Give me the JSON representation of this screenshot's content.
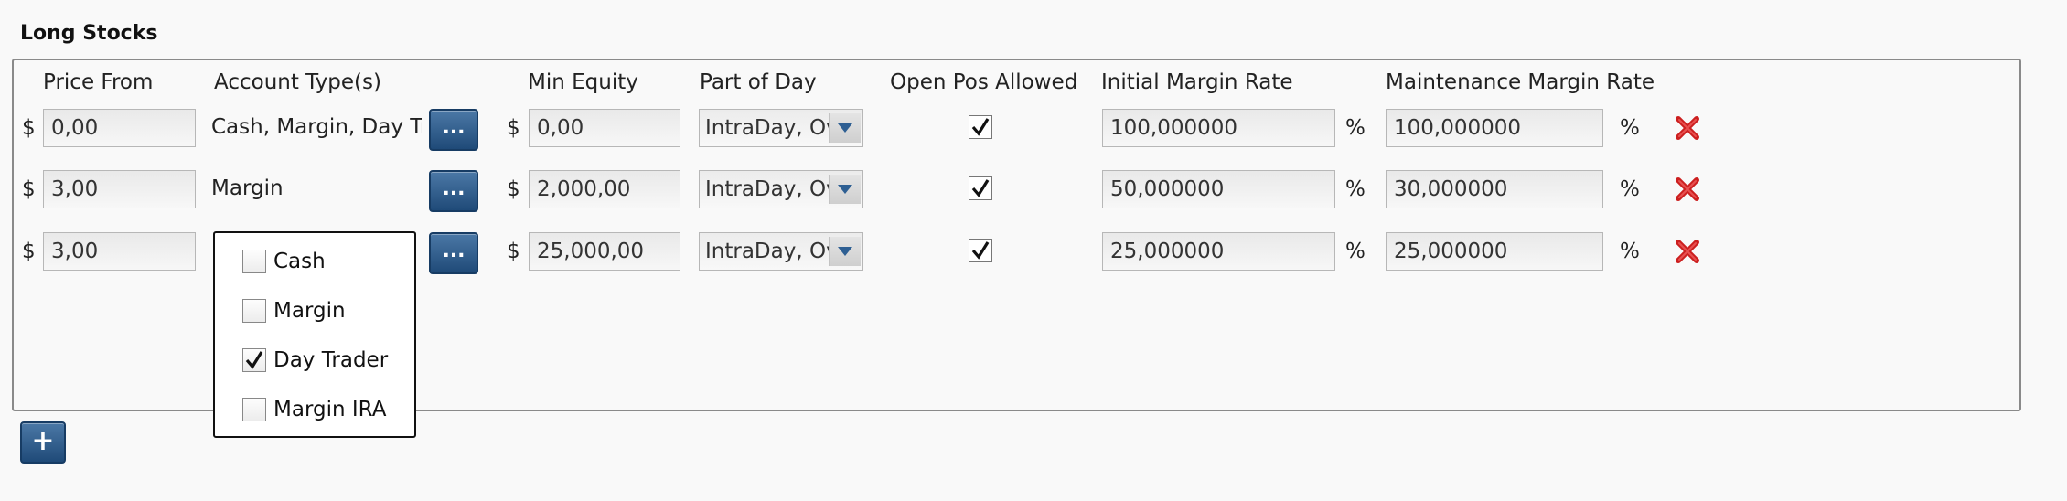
{
  "section": {
    "title": "Long Stocks"
  },
  "headers": {
    "price_from": "Price From",
    "account_types": "Account Type(s)",
    "min_equity": "Min Equity",
    "part_of_day": "Part of Day",
    "open_pos_allowed": "Open Pos Allowed",
    "initial_margin_rate": "Initial Margin Rate",
    "maintenance_margin_rate": "Maintenance Margin Rate"
  },
  "currency_symbol": "$",
  "percent_symbol": "%",
  "dots_label": "...",
  "add_label": "+",
  "rows": [
    {
      "price_from": "0,00",
      "account_types": "Cash, Margin, Day Trader",
      "min_equity": "0,00",
      "part_of_day": "IntraDay, Overnight",
      "open_pos_allowed": true,
      "initial_margin_rate": "100,000000",
      "maintenance_margin_rate": "100,000000"
    },
    {
      "price_from": "3,00",
      "account_types": "Margin",
      "min_equity": "2,000,00",
      "part_of_day": "IntraDay, Overnight",
      "open_pos_allowed": true,
      "initial_margin_rate": "50,000000",
      "maintenance_margin_rate": "30,000000"
    },
    {
      "price_from": "3,00",
      "account_types": "",
      "min_equity": "25,000,00",
      "part_of_day": "IntraDay, Overnight",
      "open_pos_allowed": true,
      "initial_margin_rate": "25,000000",
      "maintenance_margin_rate": "25,000000"
    }
  ],
  "account_type_options": [
    {
      "label": "Cash",
      "checked": false
    },
    {
      "label": "Margin",
      "checked": false
    },
    {
      "label": "Day Trader",
      "checked": true
    },
    {
      "label": "Margin IRA",
      "checked": false
    }
  ],
  "icons": {
    "dropdown": "chevron-down-icon",
    "delete": "red-x-icon",
    "check": "checkmark-icon"
  },
  "colors": {
    "button_blue": "#2a5585",
    "delete_red": "#cc1f1f",
    "dropdown_arrow": "#2e5f93"
  }
}
